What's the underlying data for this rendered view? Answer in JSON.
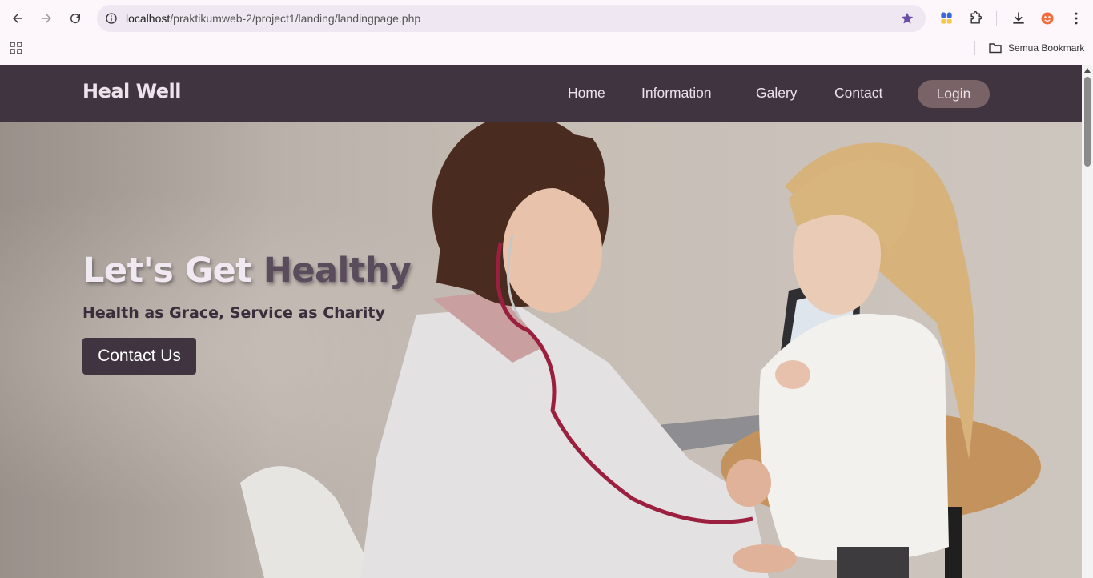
{
  "browser": {
    "url_host": "localhost",
    "url_path": "/praktikumweb-2/project1/landing/landingpage.php",
    "bookmark_folder": "Semua Bookmark"
  },
  "site": {
    "brand": "Heal Well",
    "nav": [
      "Home",
      "Information",
      "Galery",
      "Contact"
    ],
    "login": "Login"
  },
  "hero": {
    "title_part1": "Let's Get",
    "title_part2": "Healthy",
    "subtitle": "Health as Grace, Service as Charity",
    "cta": "Contact Us"
  },
  "colors": {
    "navbar": "#403441",
    "login_bg": "#7a6366",
    "cta_bg": "#403441"
  }
}
